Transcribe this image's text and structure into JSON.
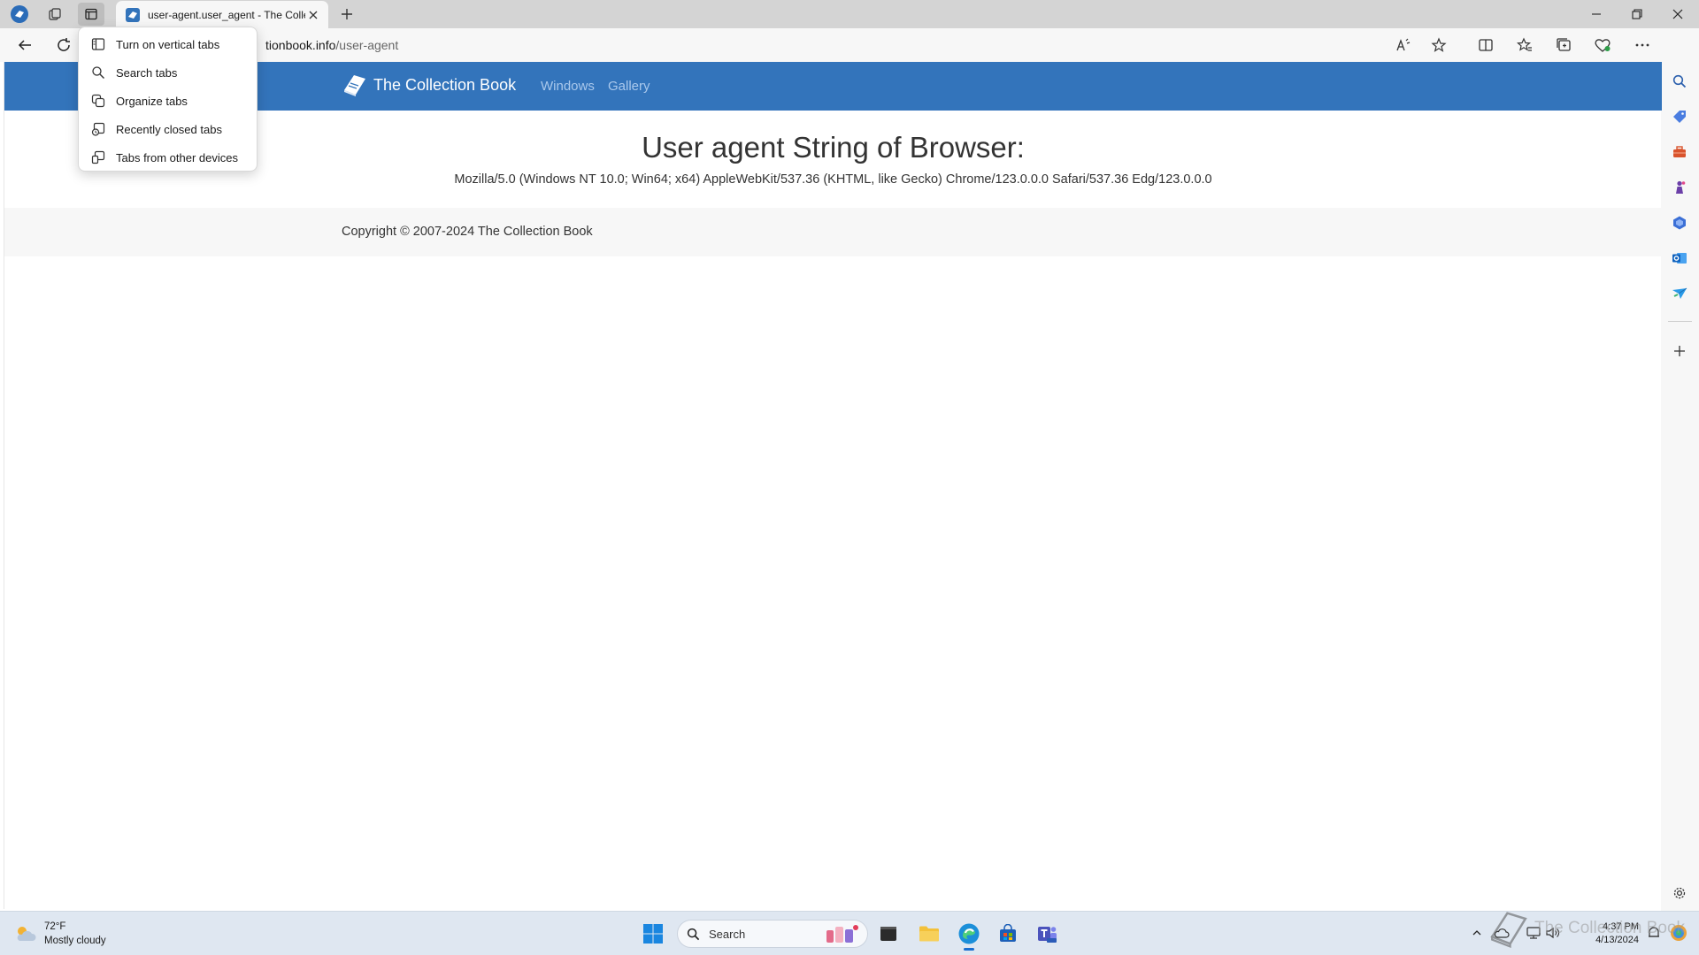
{
  "browser": {
    "tab": {
      "title": "user-agent.user_agent - The Collection Book"
    },
    "address": {
      "host": "https://www.thecollectionbook.info",
      "host_visible": "tionbook.info",
      "path": "/user-agent"
    },
    "tab_menu": {
      "items": [
        {
          "label": "Turn on vertical tabs",
          "icon": "vertical-tabs-icon"
        },
        {
          "label": "Search tabs",
          "icon": "search-icon"
        },
        {
          "label": "Organize tabs",
          "icon": "organize-tabs-icon"
        },
        {
          "label": "Recently closed tabs",
          "icon": "recently-closed-icon"
        },
        {
          "label": "Tabs from other devices",
          "icon": "devices-icon"
        }
      ]
    }
  },
  "site": {
    "brand": "The Collection Book",
    "nav": [
      "Windows",
      "Gallery"
    ],
    "heading": "User agent String of Browser:",
    "user_agent": "Mozilla/5.0 (Windows NT 10.0; Win64; x64) AppleWebKit/537.36 (KHTML, like Gecko) Chrome/123.0.0.0 Safari/537.36 Edg/123.0.0.0",
    "footer": "Copyright © 2007-2024 The Collection Book"
  },
  "taskbar": {
    "weather": {
      "temp": "72°F",
      "condition": "Mostly cloudy"
    },
    "search_label": "Search",
    "clock": {
      "time": "4:37 PM",
      "date": "4/13/2024"
    }
  },
  "watermark": "The Collection Book",
  "colors": {
    "navbar": "#3374bb",
    "navlink": "#a9c8ec",
    "tab_active": "#f7f7f7",
    "titlebar": "#d4d4d4"
  }
}
